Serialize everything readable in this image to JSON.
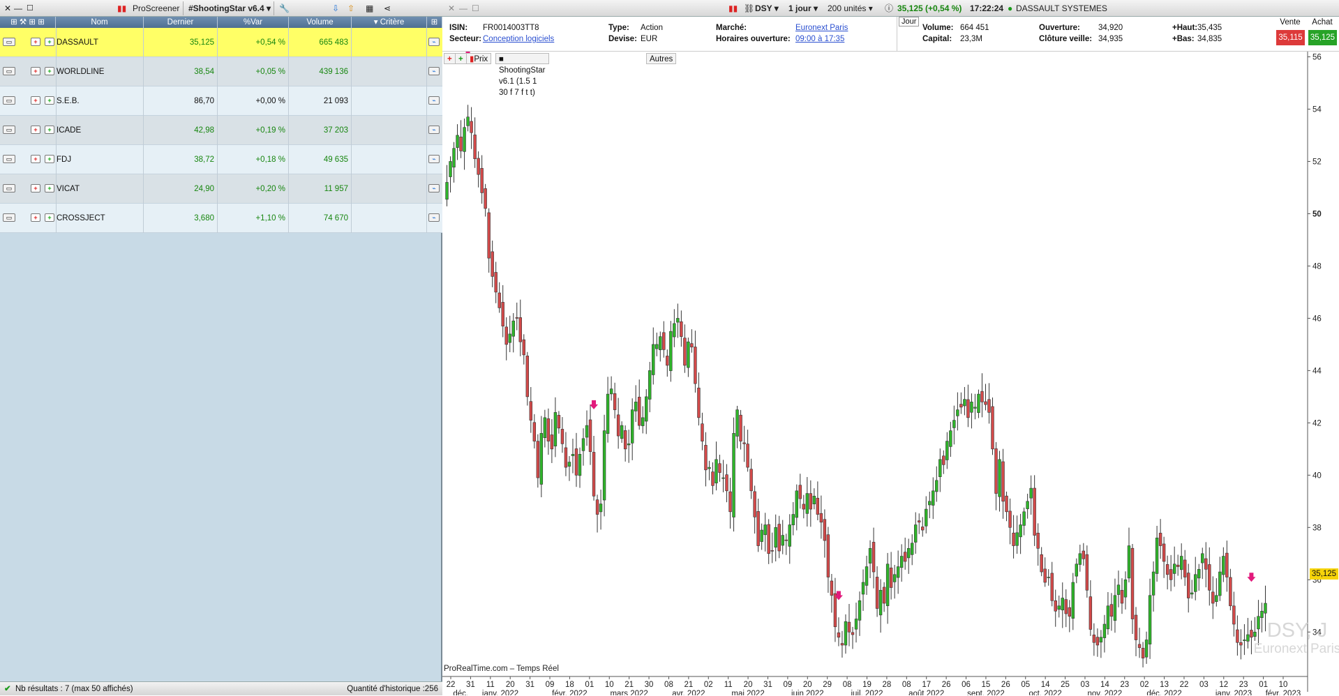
{
  "screener": {
    "toolbar": {
      "title": "ProScreener",
      "screen_name": "#ShootingStar v6.4"
    },
    "columns": [
      "Nom",
      "Dernier",
      "%Var",
      "Volume",
      "Critère"
    ],
    "rows": [
      {
        "name": "DASSAULT SYSTEMES",
        "last": "35,125",
        "var": "+0,54 %",
        "volume": "665 483",
        "selected": true
      },
      {
        "name": "WORLDLINE",
        "last": "38,54",
        "var": "+0,05 %",
        "volume": "439 136"
      },
      {
        "name": "S.E.B.",
        "last": "86,70",
        "var": "+0,00 %",
        "volume": "21 093"
      },
      {
        "name": "ICADE",
        "last": "42,98",
        "var": "+0,19 %",
        "volume": "37 203"
      },
      {
        "name": "FDJ",
        "last": "38,72",
        "var": "+0,18 %",
        "volume": "49 635"
      },
      {
        "name": "VICAT",
        "last": "24,90",
        "var": "+0,20 %",
        "volume": "11 957"
      },
      {
        "name": "CROSSJECT",
        "last": "3,680",
        "var": "+1,10 %",
        "volume": "74 670"
      }
    ],
    "footer": {
      "results": "Nb résultats : 7 (max 50 affichés)",
      "history": "Quantité d'historique :256"
    }
  },
  "chart_window": {
    "toolbar": {
      "ticker": "DSY",
      "period": "1 jour",
      "units": "200 unités",
      "quote": "35,125 (+0,54 %)",
      "time": "17:22:24",
      "name": "DASSAULT SYSTEMES"
    },
    "info": {
      "isin_label": "ISIN:",
      "isin": "FR0014003TT8",
      "sector_label": "Secteur:",
      "sector": "Conception logiciels",
      "type_label": "Type:",
      "type": "Action",
      "currency_label": "Devise:",
      "currency": "EUR",
      "market_label": "Marché:",
      "market": "Euronext Paris",
      "hours_label": "Horaires ouverture:",
      "hours": "09:00 à 17:35",
      "tab": "Jour",
      "volume_label": "Volume:",
      "volume": "664 451",
      "capital_label": "Capital:",
      "capital": "23,3M",
      "open_label": "Ouverture:",
      "open": "34,920",
      "prev_close_label": "Clôture veille:",
      "prev_close": "34,935",
      "high_label": "+Haut:",
      "high": "35,435",
      "low_label": "+Bas:",
      "low": "34,835",
      "sell_label": "Vente",
      "sell": "35,115",
      "buy_label": "Achat",
      "buy": "35,125"
    },
    "legend": {
      "price": "Prix",
      "indicator": "ShootingStar v6.1 (1.5 1 30 f 7 f t t)",
      "others": "Autres"
    },
    "price_tag": "35,125",
    "watermark_ticker": "DSY, J",
    "watermark_market": "Euronext Paris",
    "source": "ProRealTime.com – Temps Réel"
  },
  "chart_data": {
    "type": "candlestick",
    "y_ticks": [
      34,
      36,
      38,
      40,
      42,
      44,
      46,
      48,
      50,
      52,
      54,
      56
    ],
    "ylim": [
      32.3,
      56.2
    ],
    "x_tick_days": [
      "22",
      "31",
      "11",
      "20",
      "31",
      "09",
      "18",
      "01",
      "10",
      "21",
      "30",
      "08",
      "21",
      "02",
      "11",
      "20",
      "31",
      "09",
      "20",
      "29",
      "08",
      "19",
      "28",
      "08",
      "17",
      "26",
      "06",
      "15",
      "26",
      "05",
      "14",
      "25",
      "03",
      "14",
      "23",
      "02",
      "13",
      "22",
      "03",
      "12",
      "23",
      "01",
      "10"
    ],
    "x_month_labels": [
      "déc.",
      "janv. 2022",
      "févr. 2022",
      "mars 2022",
      "avr. 2022",
      "mai 2022",
      "juin 2022",
      "juil. 2022",
      "août 2022",
      "sept. 2022",
      "oct. 2022",
      "nov. 2022",
      "déc. 2022",
      "janv. 2023",
      "févr. 2023"
    ],
    "signal_arrows_near_price": [
      56,
      42.6,
      35.3,
      36
    ],
    "closes": [
      51.2,
      52.0,
      52.5,
      53.0,
      52.4,
      53.3,
      53.7,
      53.1,
      52.1,
      51.5,
      50.8,
      50.2,
      48.3,
      47.6,
      47.0,
      46.4,
      45.7,
      45.0,
      45.4,
      45.9,
      46.0,
      45.1,
      44.6,
      43.0,
      42.1,
      41.3,
      39.9,
      41.6,
      42.2,
      41.3,
      41.0,
      42.4,
      41.8,
      41.2,
      40.3,
      40.5,
      40.8,
      40.0,
      40.8,
      41.4,
      41.9,
      40.9,
      39.2,
      38.5,
      38.9,
      41.7,
      43.1,
      43.3,
      42.5,
      41.5,
      41.9,
      41.0,
      41.2,
      42.5,
      42.8,
      41.9,
      42.2,
      43.0,
      44.0,
      45.0,
      45.0,
      45.3,
      44.8,
      44.2,
      45.5,
      45.8,
      46.0,
      45.3,
      44.2,
      45.1,
      44.9,
      43.5,
      42.2,
      41.3,
      40.2,
      40.3,
      39.6,
      40.6,
      40.1,
      39.9,
      39.4,
      38.6,
      41.6,
      42.5,
      41.3,
      41.2,
      40.3,
      39.4,
      38.4,
      37.3,
      37.9,
      38.1,
      37.0,
      37.1,
      38.0,
      37.1,
      37.7,
      37.5,
      38.1,
      38.5,
      39.4,
      39.1,
      38.7,
      39.3,
      38.7,
      39.2,
      38.5,
      38.2,
      37.5,
      36.1,
      35.4,
      34.2,
      33.8,
      33.5,
      34.4,
      34.0,
      33.9,
      34.5,
      35.2,
      35.9,
      36.5,
      37.2,
      36.3,
      34.9,
      35.6,
      35.1,
      36.6,
      35.7,
      36.2,
      36.5,
      36.9,
      36.7,
      37.2,
      37.4,
      38.1,
      38.2,
      37.9,
      38.7,
      39.0,
      39.4,
      39.8,
      40.6,
      40.4,
      41.3,
      41.7,
      42.1,
      42.5,
      42.6,
      42.9,
      42.2,
      42.8,
      42.6,
      43.1,
      42.8,
      42.7,
      42.4,
      41.0,
      39.3,
      40.6,
      39.0,
      38.6,
      38.0,
      37.3,
      37.8,
      38.1,
      38.6,
      39.0,
      39.5,
      37.7,
      37.2,
      36.3,
      35.9,
      36.1,
      35.2,
      34.8,
      35.0,
      35.3,
      34.7,
      34.6,
      35.9,
      36.6,
      37.0,
      36.8,
      35.6,
      34.1,
      33.6,
      33.5,
      33.8,
      34.3,
      35.0,
      34.6,
      35.4,
      35.8,
      35.1,
      36.0,
      37.3,
      34.5,
      33.7,
      33.4,
      33.0,
      33.7,
      35.4,
      36.3,
      37.6,
      37.3,
      36.7,
      36.2,
      36.0,
      36.6,
      36.5,
      36.9,
      36.1,
      35.3,
      35.5,
      36.2,
      36.4,
      37.0,
      36.4,
      35.6,
      35.1,
      35.4,
      36.3,
      36.9,
      36.1,
      35.0,
      34.3,
      33.6,
      33.5,
      33.7,
      33.9,
      33.8,
      34.0,
      34.6,
      34.8,
      35.1
    ]
  }
}
